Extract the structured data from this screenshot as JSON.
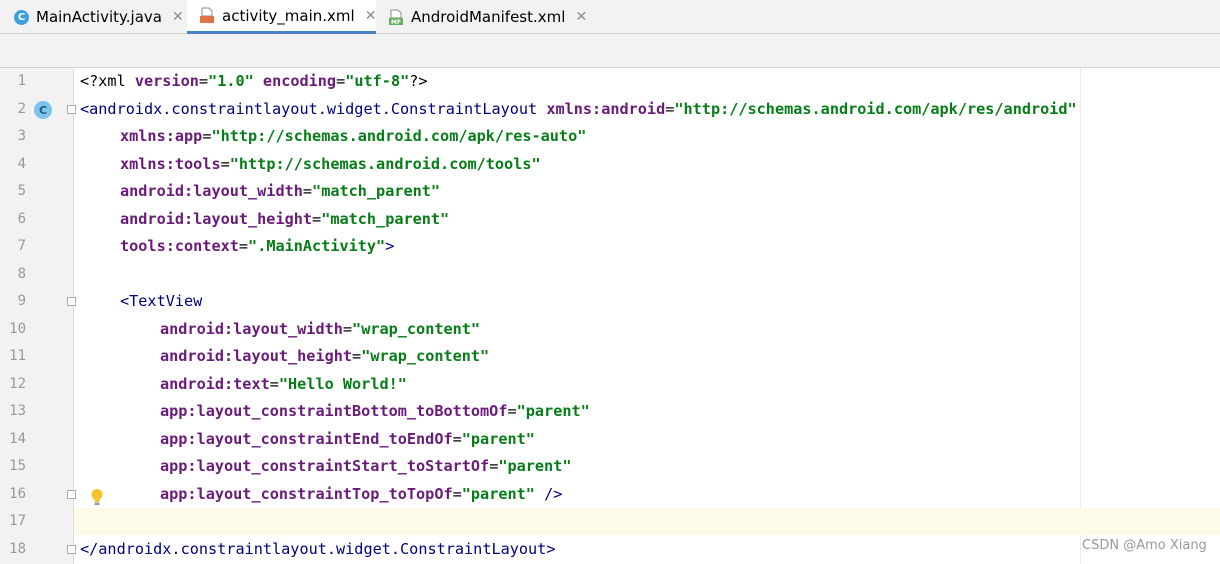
{
  "tabs": [
    {
      "label": "MainActivity.java",
      "icon": "java-class-icon",
      "active": false
    },
    {
      "label": "activity_main.xml",
      "icon": "xml-file-icon",
      "active": true
    },
    {
      "label": "AndroidManifest.xml",
      "icon": "manifest-file-icon",
      "active": false
    }
  ],
  "tab_close_glyph": "✕",
  "gutter": {
    "line_numbers": [
      "1",
      "2",
      "3",
      "4",
      "5",
      "6",
      "7",
      "8",
      "9",
      "10",
      "11",
      "12",
      "13",
      "14",
      "15",
      "16",
      "17",
      "18"
    ],
    "class_badge": "C"
  },
  "icon_labels": {
    "java_badge": "C",
    "manifest_badge": "MF",
    "xml_badge": "<>"
  },
  "code": {
    "l1": {
      "pi_open": "<?xml ",
      "a1": "version",
      "eq1": "=",
      "v1": "\"1.0\"",
      "sp": " ",
      "a2": "encoding",
      "eq2": "=",
      "v2": "\"utf-8\"",
      "pi_close": "?>"
    },
    "l2": {
      "open": "<androidx.constraintlayout.widget.ConstraintLayout ",
      "ns": "xmlns:",
      "attr": "android",
      "eq": "=",
      "val": "\"http://schemas.android.com/apk/res/android\""
    },
    "l3": {
      "ns": "xmlns:",
      "attr": "app",
      "eq": "=",
      "val": "\"http://schemas.android.com/apk/res-auto\""
    },
    "l4": {
      "ns": "xmlns:",
      "attr": "tools",
      "eq": "=",
      "val": "\"http://schemas.android.com/tools\""
    },
    "l5": {
      "ns": "android:",
      "attr": "layout_width",
      "eq": "=",
      "val": "\"match_parent\""
    },
    "l6": {
      "ns": "android:",
      "attr": "layout_height",
      "eq": "=",
      "val": "\"match_parent\""
    },
    "l7": {
      "ns": "tools:",
      "attr": "context",
      "eq": "=",
      "val": "\".MainActivity\"",
      "close": ">"
    },
    "l9": {
      "open": "<TextView"
    },
    "l10": {
      "ns": "android:",
      "attr": "layout_width",
      "eq": "=",
      "val": "\"wrap_content\""
    },
    "l11": {
      "ns": "android:",
      "attr": "layout_height",
      "eq": "=",
      "val": "\"wrap_content\""
    },
    "l12": {
      "ns": "android:",
      "attr": "text",
      "eq": "=",
      "val": "\"Hello World!\""
    },
    "l13": {
      "ns": "app:",
      "attr": "layout_constraintBottom_toBottomOf",
      "eq": "=",
      "val": "\"parent\""
    },
    "l14": {
      "ns": "app:",
      "attr": "layout_constraintEnd_toEndOf",
      "eq": "=",
      "val": "\"parent\""
    },
    "l15": {
      "ns": "app:",
      "attr": "layout_constraintStart_toStartOf",
      "eq": "=",
      "val": "\"parent\""
    },
    "l16": {
      "ns": "app:",
      "attr": "layout_constraintTop_toTopOf",
      "eq": "=",
      "val": "\"parent\"",
      "close": " />"
    },
    "l18": {
      "close_tag": "</androidx.constraintlayout.widget.ConstraintLayout>"
    }
  },
  "watermark": "CSDN @Amo Xiang",
  "colors": {
    "accent": "#4a83c6",
    "xml_value": "#067d17",
    "xml_attr": "#6a1b7a",
    "xml_tag": "#000080",
    "current_line": "#fdfbe8"
  }
}
